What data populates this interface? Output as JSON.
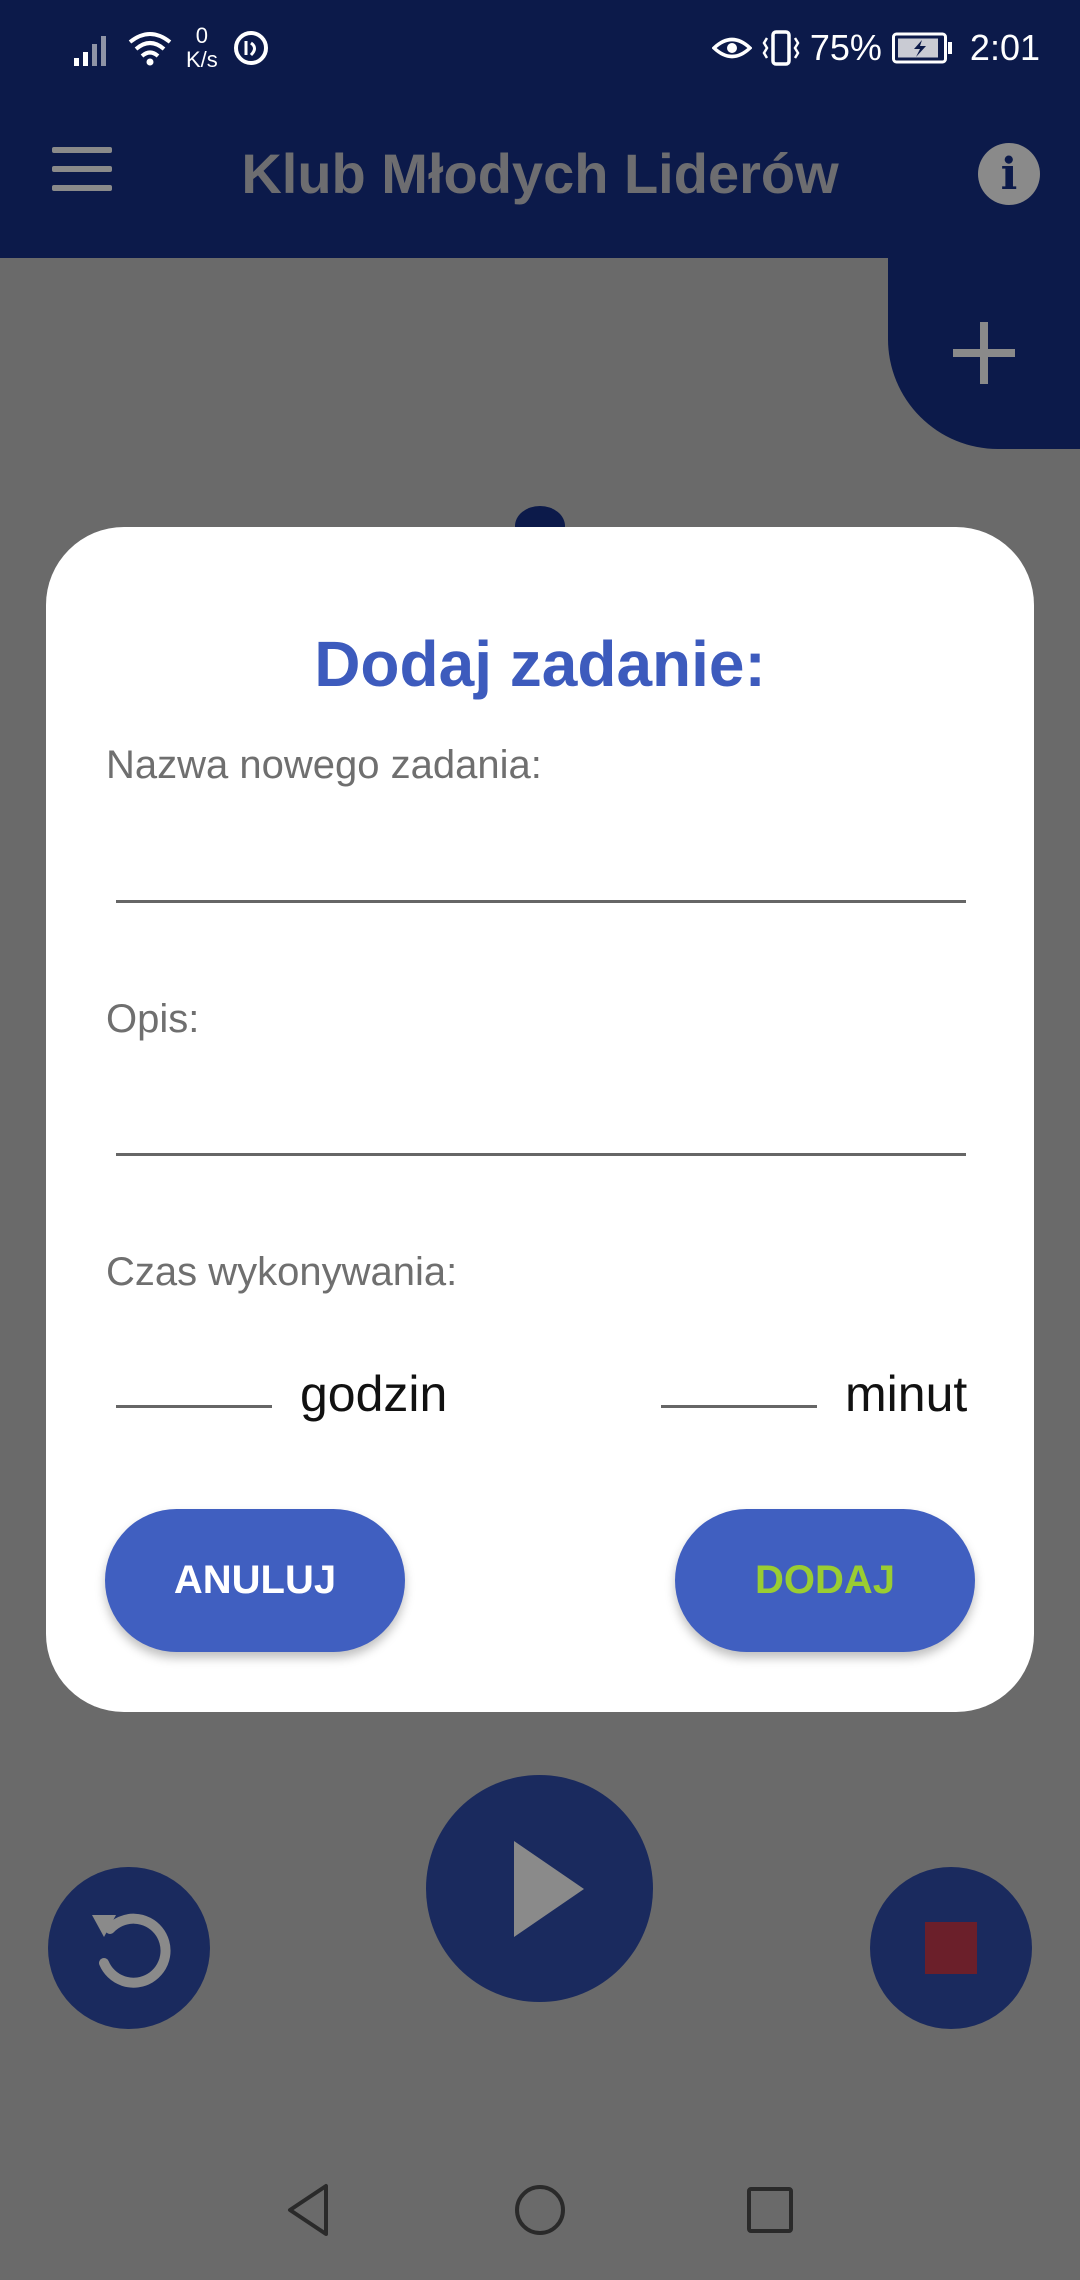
{
  "status_bar": {
    "net_speed_value": "0",
    "net_speed_unit": "K/s",
    "battery": "75%",
    "time": "2:01"
  },
  "app_bar": {
    "title": "Klub Młodych Liderów"
  },
  "dialog": {
    "title": "Dodaj zadanie:",
    "name_label": "Nazwa nowego zadania:",
    "name_value": "",
    "description_label": "Opis:",
    "description_value": "",
    "duration_label": "Czas wykonywania:",
    "hours_value": "",
    "hours_unit": "godzin",
    "minutes_value": "",
    "minutes_unit": "minut",
    "cancel_label": "ANULUJ",
    "add_label": "DODAJ"
  },
  "colors": {
    "app_bar": "#0c1a4a",
    "dialog_title": "#3d5bbd",
    "button_bg": "#405fc0",
    "add_label": "#9acd32",
    "cancel_label": "#ffffff",
    "stop_square": "#6b1f2a"
  },
  "icons": {
    "menu": "hamburger-icon",
    "info": "info-icon",
    "add": "plus-icon",
    "play": "play-icon",
    "reset": "replay-icon",
    "stop": "stop-icon",
    "nav_back": "back-triangle-icon",
    "nav_home": "home-circle-icon",
    "nav_recents": "recents-square-icon"
  }
}
